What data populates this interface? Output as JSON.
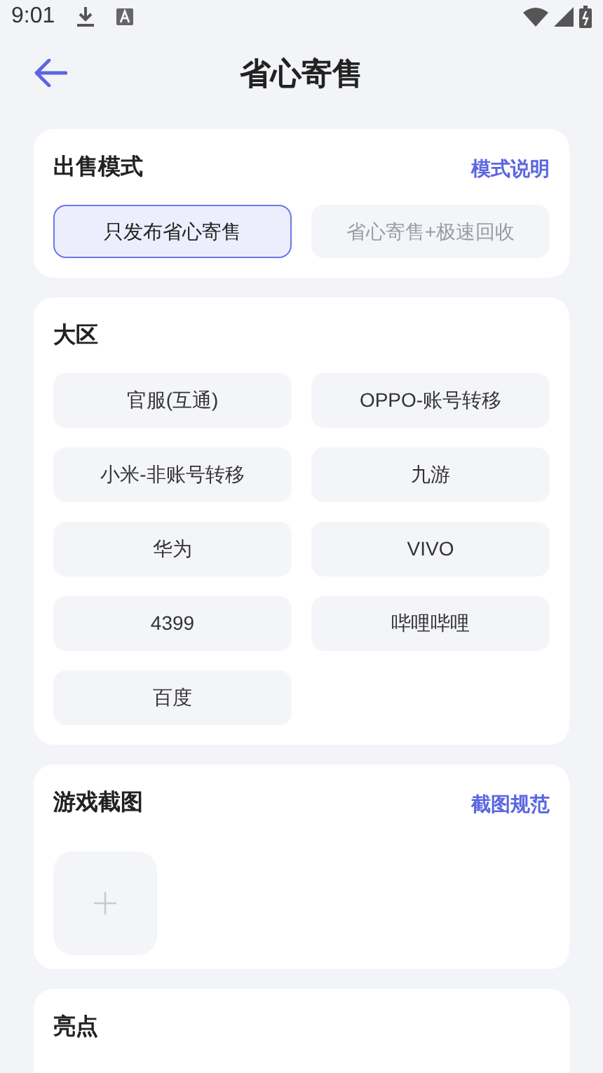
{
  "status_bar": {
    "time": "9:01"
  },
  "header": {
    "title": "省心寄售"
  },
  "sale_mode": {
    "title": "出售模式",
    "link": "模式说明",
    "options": [
      {
        "label": "只发布省心寄售",
        "selected": true,
        "disabled": false
      },
      {
        "label": "省心寄售+极速回收",
        "selected": false,
        "disabled": true
      }
    ]
  },
  "region": {
    "title": "大区",
    "options": [
      {
        "label": "官服(互通)",
        "selected": false
      },
      {
        "label": "OPPO-账号转移",
        "selected": false
      },
      {
        "label": "小米-非账号转移",
        "selected": false
      },
      {
        "label": "九游",
        "selected": false
      },
      {
        "label": "华为",
        "selected": false
      },
      {
        "label": "VIVO",
        "selected": false
      },
      {
        "label": "4399",
        "selected": false
      },
      {
        "label": "哔哩哔哩",
        "selected": false
      },
      {
        "label": "百度",
        "selected": false
      }
    ]
  },
  "screenshots": {
    "title": "游戏截图",
    "link": "截图规范"
  },
  "highlights": {
    "title": "亮点"
  }
}
